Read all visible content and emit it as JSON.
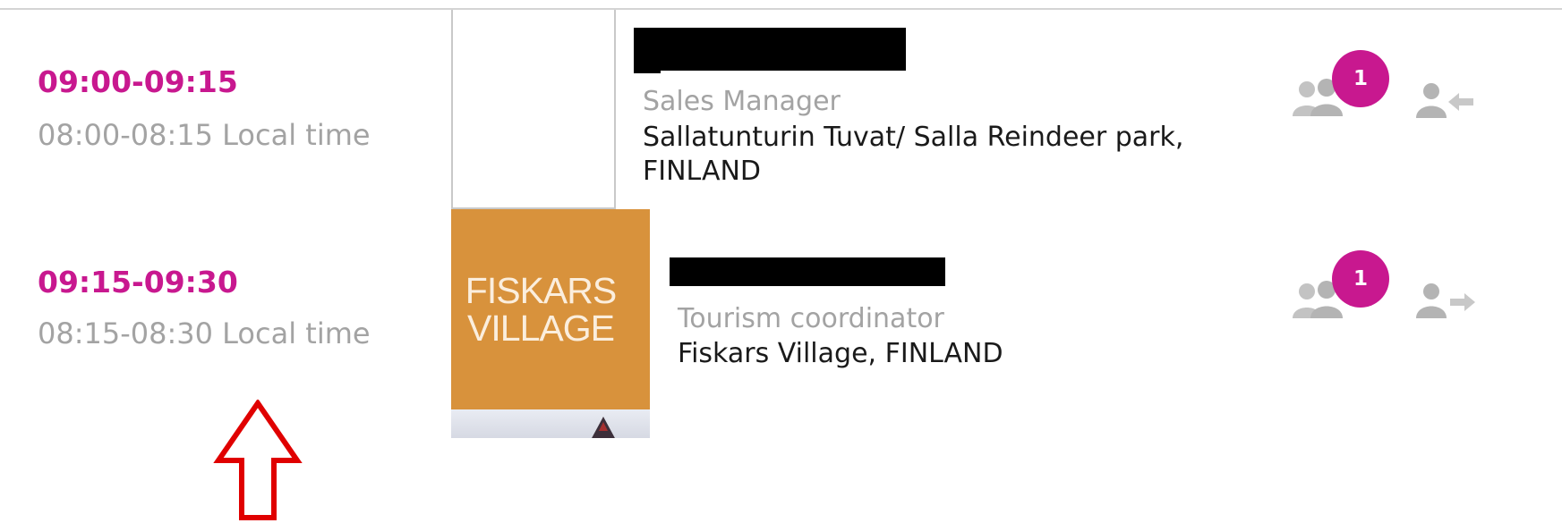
{
  "colors": {
    "accent": "#c8188f",
    "muted": "#a3a3a3",
    "logo_bg": "#d8923c",
    "annotation": "#e00000"
  },
  "slots": [
    {
      "time": "09:00-09:15",
      "local_time": "08:00-08:15 Local time",
      "role": "Sales Manager",
      "company": "Sallatunturin Tuvat/ Salla Reindeer park, FINLAND",
      "badge": "1",
      "action_icon": "person-incoming-arrow-icon"
    },
    {
      "time": "09:15-09:30",
      "local_time": "08:15-08:30 Local time",
      "logo_line1": "FISKARS",
      "logo_line2": "VILLAGE",
      "role": "Tourism coordinator",
      "company": "Fiskars Village, FINLAND",
      "badge": "1",
      "action_icon": "person-outgoing-arrow-icon"
    }
  ]
}
